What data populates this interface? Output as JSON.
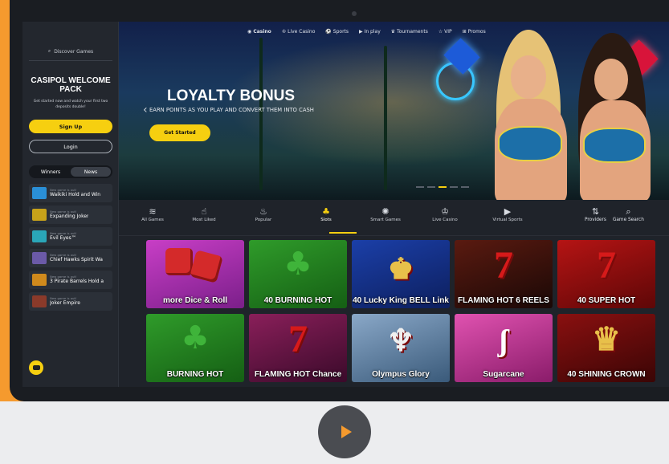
{
  "topnav": {
    "items": [
      {
        "label": "Casino",
        "icon": "casino-chip-icon"
      },
      {
        "label": "Live Casino",
        "icon": "dealer-icon"
      },
      {
        "label": "Sports",
        "icon": "ball-icon"
      },
      {
        "label": "In play",
        "icon": "play-screen-icon"
      },
      {
        "label": "Tournaments",
        "icon": "trophy-icon"
      },
      {
        "label": "VIP",
        "icon": "star-icon"
      },
      {
        "label": "Promos",
        "icon": "gift-icon"
      }
    ]
  },
  "sidebar": {
    "discover": "Discover Games",
    "welcome_title": "CASIPOL WELCOME PACK",
    "welcome_sub": "Get started now and watch your first two deposits double!",
    "signup": "Sign Up",
    "login": "Login",
    "tabs": [
      "Winners",
      "News"
    ],
    "news_prefix": "New game is out!",
    "news": [
      {
        "name": "Waikiki Hold and Win",
        "color": "#2a8fd6"
      },
      {
        "name": "Expanding Joker",
        "color": "#c7a21a"
      },
      {
        "name": "Evil Eyes™",
        "color": "#2aa6b8"
      },
      {
        "name": "Chief Hawks Spirit Wa",
        "color": "#6b5aa8"
      },
      {
        "name": "3 Pirate Barrels Hold a",
        "color": "#d08a1c"
      },
      {
        "name": "Joker Empire",
        "color": "#8a3a2a"
      }
    ]
  },
  "hero": {
    "title": "LOYALTY BONUS",
    "subtitle": "EARN POINTS AS YOU PLAY AND CONVERT THEM INTO CASH",
    "cta": "Get Started"
  },
  "categories": [
    {
      "label": "All Games",
      "icon": "layers-icon"
    },
    {
      "label": "Most Liked",
      "icon": "thumbs-up-icon"
    },
    {
      "label": "Popular",
      "icon": "fire-icon"
    },
    {
      "label": "Slots",
      "icon": "cherries-icon"
    },
    {
      "label": "Smart Games",
      "icon": "smart-icon"
    },
    {
      "label": "Live Casino",
      "icon": "dealer-icon"
    },
    {
      "label": "Virtual Sports",
      "icon": "play-screen-icon"
    }
  ],
  "providers": {
    "providers_label": "Providers",
    "search_label": "Game Search"
  },
  "games": [
    {
      "name": "more Dice & Roll",
      "bg": "linear-gradient(160deg,#c83ec6,#7b1f8a)",
      "art": "dice"
    },
    {
      "name": "40 BURNING HOT",
      "bg": "linear-gradient(160deg,#2f9b2a,#155f14)",
      "art": "clover"
    },
    {
      "name": "40 Lucky King BELL Link",
      "bg": "linear-gradient(160deg,#1b3fa8,#0d1f5e)",
      "art": "king"
    },
    {
      "name": "FLAMING HOT 6 REELS",
      "bg": "linear-gradient(160deg,#5a1a10,#1a0806)",
      "art": "seven"
    },
    {
      "name": "40 SUPER HOT",
      "bg": "linear-gradient(160deg,#b51414,#5e0707)",
      "art": "seven"
    },
    {
      "name": "BURNING HOT",
      "bg": "linear-gradient(160deg,#2f9b2a,#155f14)",
      "art": "clover"
    },
    {
      "name": "FLAMING HOT Chance",
      "bg": "linear-gradient(160deg,#8a1f5a,#3a0a2a)",
      "art": "seven"
    },
    {
      "name": "Olympus Glory",
      "bg": "linear-gradient(160deg,#8aa8c8,#3a5a7a)",
      "art": "zeus"
    },
    {
      "name": "Sugarcane",
      "bg": "linear-gradient(160deg,#e052b0,#8a1c6a)",
      "art": "candy"
    },
    {
      "name": "40 SHINING CROWN",
      "bg": "linear-gradient(160deg,#8a1010,#3a0505)",
      "art": "crown"
    }
  ]
}
